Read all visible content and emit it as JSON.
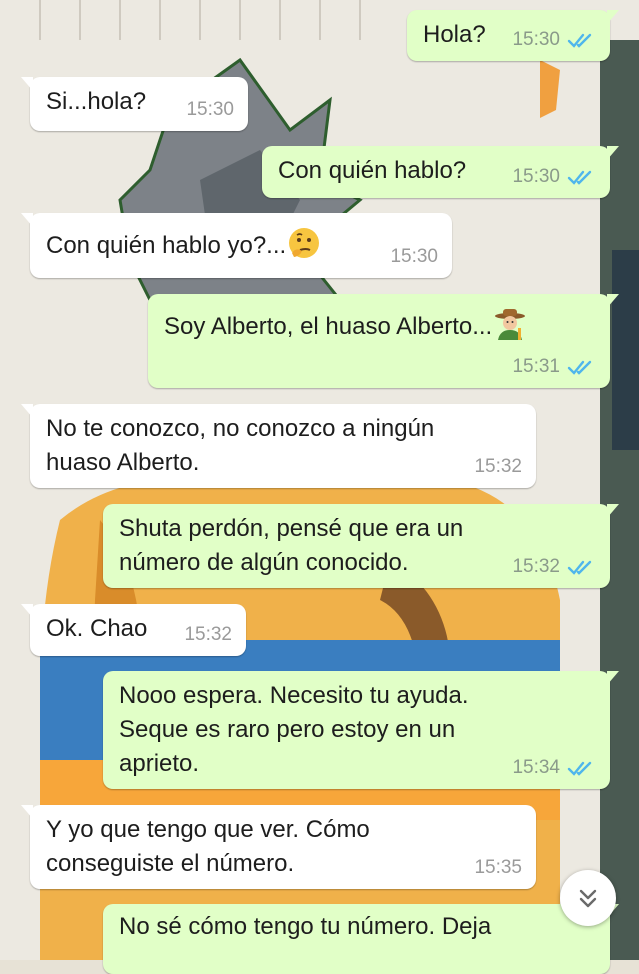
{
  "colors": {
    "incoming_bubble": "#ffffff",
    "outgoing_bubble": "#e1ffc7",
    "read_ticks": "#4fb6ec"
  },
  "messages": [
    {
      "direction": "out",
      "text": "Hola?",
      "time": "15:30",
      "read": true
    },
    {
      "direction": "in",
      "text": "Si...hola?",
      "time": "15:30"
    },
    {
      "direction": "out",
      "text": "Con quién hablo?",
      "time": "15:30",
      "read": true
    },
    {
      "direction": "in",
      "text": "Con quién hablo yo?...",
      "emoji": "thinking-face-icon",
      "time": "15:30"
    },
    {
      "direction": "out",
      "text": "Soy Alberto, el huaso Alberto...",
      "emoji": "farmer-icon",
      "time": "15:31",
      "read": true
    },
    {
      "direction": "in",
      "text": "No te conozco, no conozco a ningún\nhuaso Alberto.",
      "time": "15:32"
    },
    {
      "direction": "out",
      "text": "Shuta perdón, pensé que era un\nnúmero de algún conocido.",
      "time": "15:32",
      "read": true
    },
    {
      "direction": "in",
      "text": "Ok. Chao",
      "time": "15:32"
    },
    {
      "direction": "out",
      "text": "Nooo espera. Necesito tu ayuda.\nSeque es raro pero estoy en un\naprieto.",
      "time": "15:34",
      "read": true
    },
    {
      "direction": "in",
      "text": "Y yo que tengo que ver. Cómo\nconseguiste el número.",
      "time": "15:35"
    },
    {
      "direction": "out",
      "text": "No sé cómo tengo tu número. Deja",
      "time": "",
      "read": false
    }
  ],
  "scroll_button": {
    "icon": "double-chevron-down-icon"
  }
}
